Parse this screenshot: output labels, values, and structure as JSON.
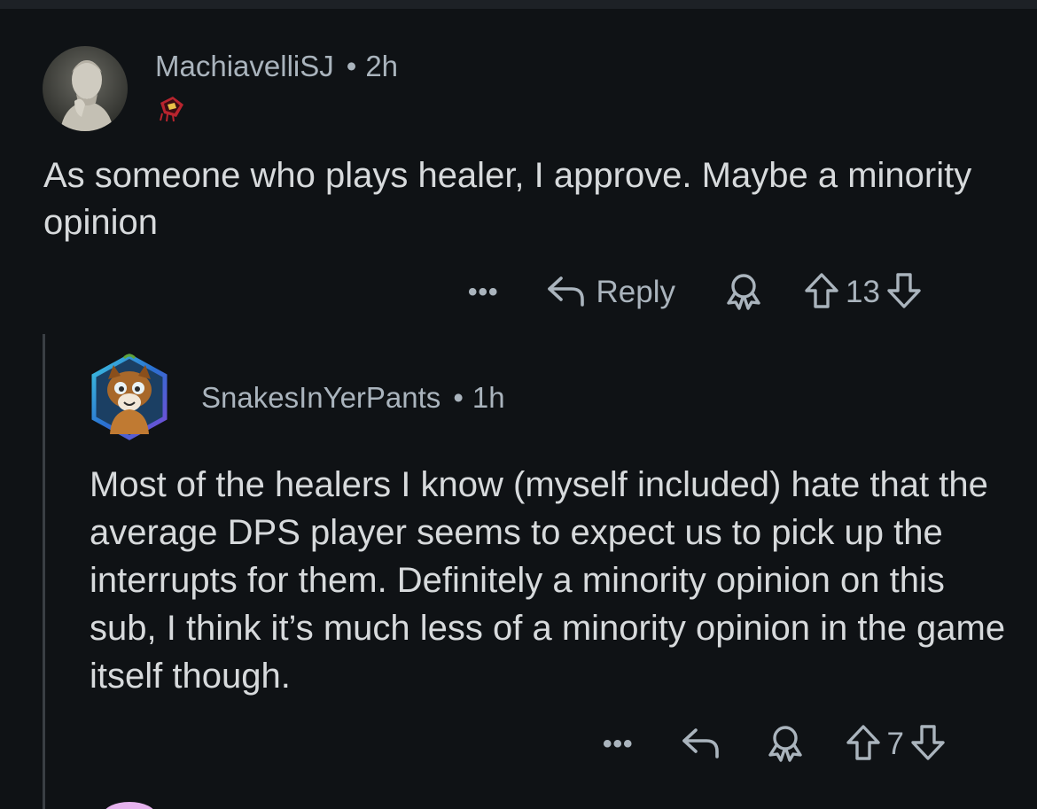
{
  "comments": [
    {
      "username": "MachiavelliSJ",
      "separator": "•",
      "time": "2h",
      "avatar_icon": "statue-avatar",
      "flair_icon": "flair-badge-icon",
      "body": "As someone who plays healer, I approve. Maybe a minority opinion",
      "actions": {
        "more_label": "•••",
        "reply_label": "Reply",
        "vote_count": "13"
      }
    },
    {
      "username": "SnakesInYerPants",
      "separator": "•",
      "time": "1h",
      "avatar_icon": "owl-dog-nft-avatar",
      "body": "Most of the healers I know (myself included) hate that the average DPS player seems to expect us to pick up the interrupts for them. Definitely a minority opinion on this sub, I think it’s much less of a minority opinion in the game itself though.",
      "actions": {
        "more_label": "•••",
        "vote_count": "7"
      }
    }
  ],
  "colors": {
    "background": "#0f1215",
    "meta_text": "#aab4bd",
    "body_text": "#d7dadc"
  }
}
